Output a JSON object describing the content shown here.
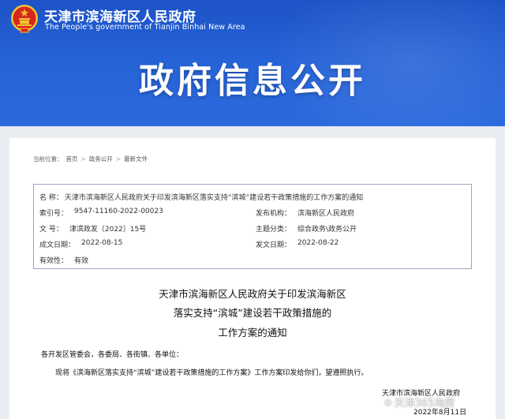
{
  "header": {
    "site_name_cn": "天津市滨海新区人民政府",
    "site_name_en": "The People's government of Tianjin Binhai New Area",
    "banner_title": "政府信息公开"
  },
  "breadcrumb": {
    "prefix": "当前位置：",
    "items": [
      "首页",
      "政务公开",
      "最新文件"
    ],
    "separator": ">"
  },
  "meta": {
    "name_label": "名  称：",
    "name_value": "天津市滨海新区人民政府关于印发滨海新区落实支持“滨城”建设若干政策措施的工作方案的通知",
    "index_label": "索引号：",
    "index_value": "9547-11160-2022-00023",
    "publisher_label": "发布机构：",
    "publisher_value": "滨海新区人民政府",
    "docno_label": "文  号：",
    "docno_value": "津滨政发〔2022〕15号",
    "category_label": "主题分类：",
    "category_value": "综合政务\\政务公开",
    "created_label": "成文日期：",
    "created_value": "2022-08-15",
    "published_label": "发文日期：",
    "published_value": "2022-08-22",
    "validity_label": "有效性：",
    "validity_value": "有效"
  },
  "document": {
    "title_line1": "天津市滨海新区人民政府关于印发滨海新区",
    "title_line2": "落实支持“滨城”建设若干政策措施的",
    "title_line3": "工作方案的通知",
    "salutation": "各开发区管委会，各委局、各街镇、各单位：",
    "paragraph": "现将《滨海新区落实支持“滨城”建设若干政策措施的工作方案》工作方案印发给你们，望遵照执行。",
    "signer": "天津市滨海新区人民政府",
    "sign_date": "2022年8月11日"
  },
  "watermark": {
    "text": "天津365淘房"
  },
  "colors": {
    "banner_blue": "#2562d6",
    "emblem_red": "#d7261e",
    "emblem_gold": "#f2c230"
  }
}
